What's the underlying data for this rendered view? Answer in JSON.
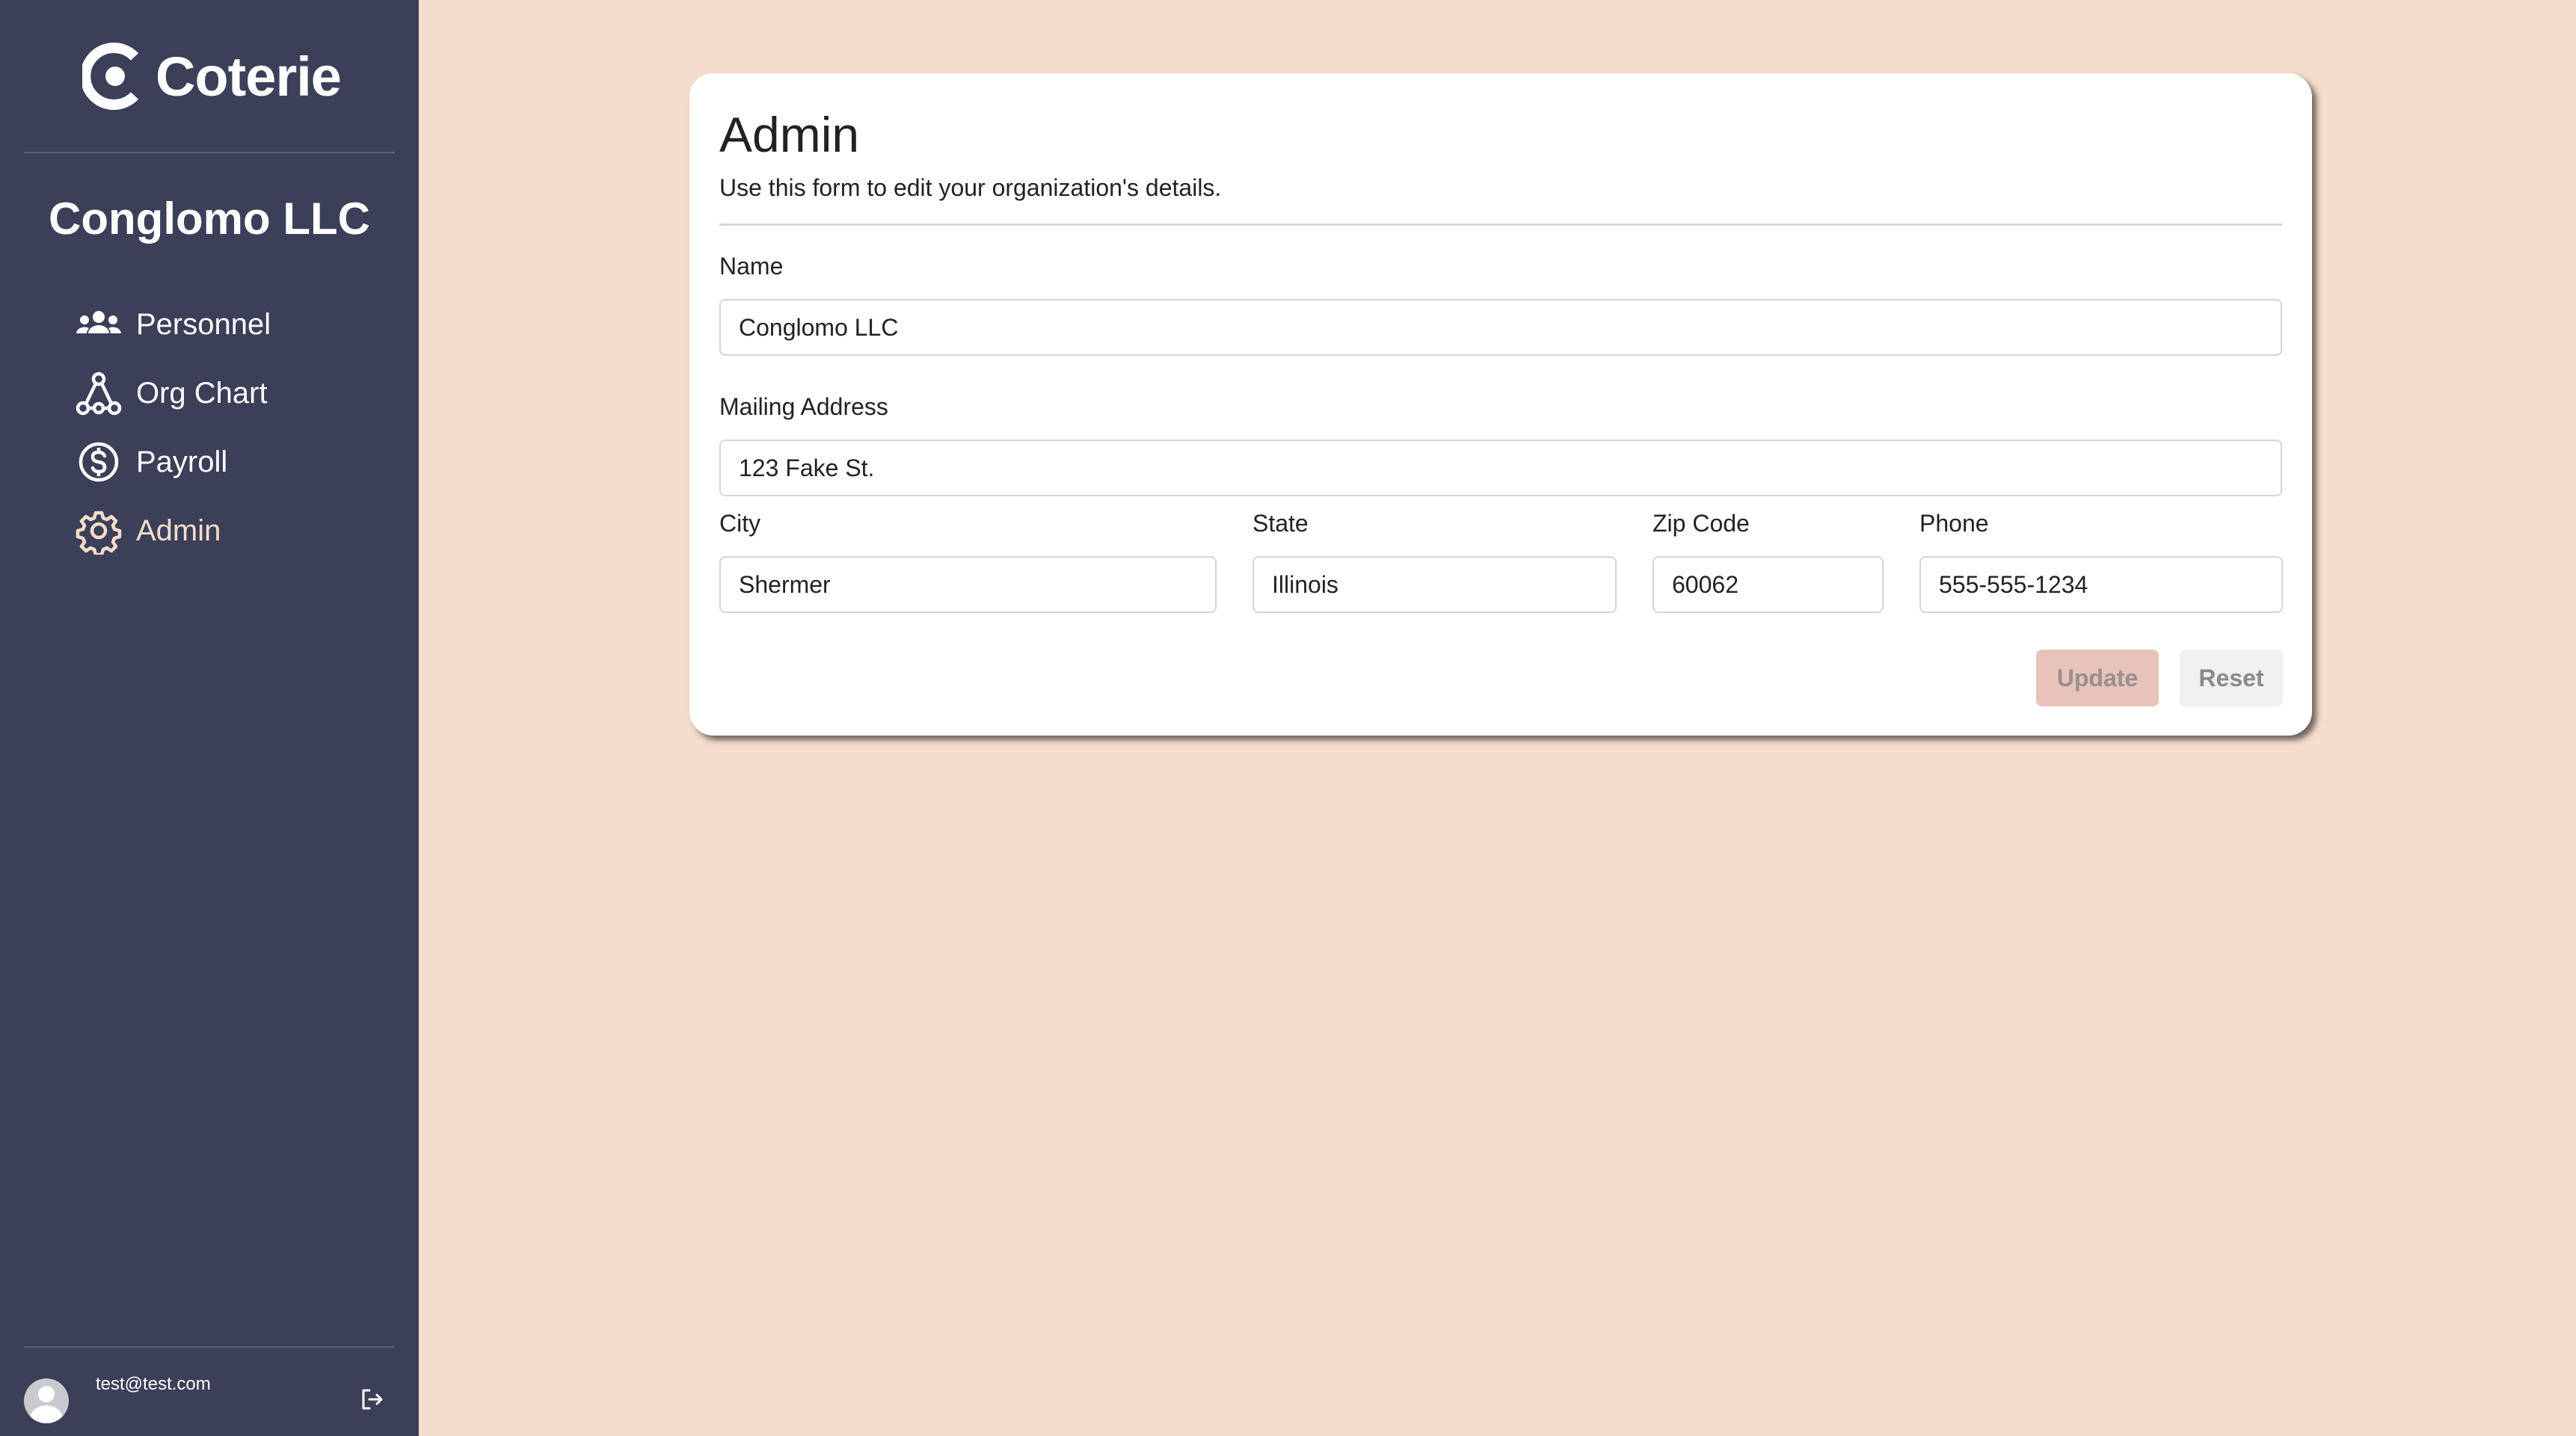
{
  "app": {
    "name": "Coterie"
  },
  "sidebar": {
    "org_name": "Conglomo LLC",
    "items": [
      {
        "label": "Personnel",
        "icon": "users-icon",
        "active": false
      },
      {
        "label": "Org Chart",
        "icon": "org-chart-icon",
        "active": false
      },
      {
        "label": "Payroll",
        "icon": "dollar-circle-icon",
        "active": false
      },
      {
        "label": "Admin",
        "icon": "gear-icon",
        "active": true
      }
    ],
    "user": {
      "email": "test@test.com"
    }
  },
  "form": {
    "title": "Admin",
    "subtitle": "Use this form to edit your organization's details.",
    "fields": {
      "name": {
        "label": "Name",
        "value": "Conglomo LLC"
      },
      "address": {
        "label": "Mailing Address",
        "value": "123 Fake St."
      },
      "city": {
        "label": "City",
        "value": "Shermer"
      },
      "state": {
        "label": "State",
        "value": "Illinois"
      },
      "zip": {
        "label": "Zip Code",
        "value": "60062"
      },
      "phone": {
        "label": "Phone",
        "value": "555-555-1234"
      }
    },
    "buttons": {
      "update": "Update",
      "reset": "Reset"
    }
  },
  "colors": {
    "background": "#f5ddcc",
    "sidebar": "#3b3f58",
    "active_nav": "#f5ddcc",
    "update_button": "#e8c3bb",
    "reset_button": "#f0f0f0"
  }
}
